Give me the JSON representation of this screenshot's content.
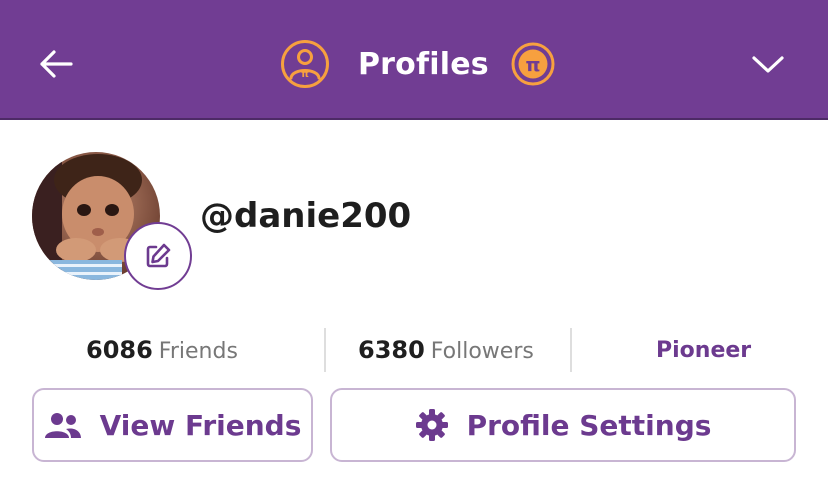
{
  "header": {
    "title": "Profiles",
    "back_icon": "arrow-left-icon",
    "dropdown_icon": "chevron-down-icon",
    "background": "#713d93",
    "accent": "#f7a03f"
  },
  "profile": {
    "username": "@danie200",
    "avatar_icon": "avatar-photo",
    "edit_icon": "pencil-square-icon"
  },
  "stats": {
    "friends_count": "6086",
    "friends_label": "Friends",
    "followers_count": "6380",
    "followers_label": "Followers",
    "pioneer_label": "Pioneer"
  },
  "actions": {
    "view_friends_label": "View Friends",
    "view_friends_icon": "users-icon",
    "profile_settings_label": "Profile Settings",
    "profile_settings_icon": "gear-icon"
  }
}
